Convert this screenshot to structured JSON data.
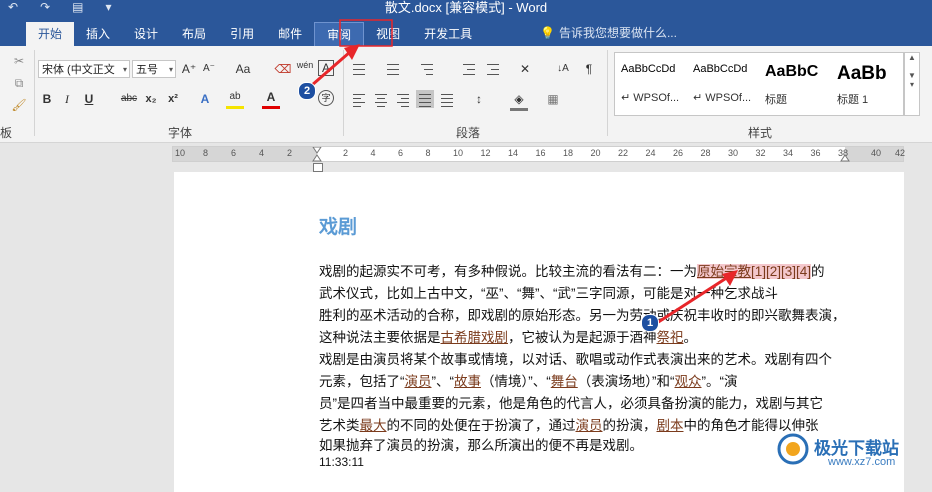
{
  "titlebar": {
    "title": "散文.docx [兼容模式] - Word",
    "qat": [
      "↶",
      "↷",
      "▤",
      "▾"
    ]
  },
  "tabs": [
    {
      "label": "开始",
      "name": "tab-home"
    },
    {
      "label": "插入",
      "name": "tab-insert"
    },
    {
      "label": "设计",
      "name": "tab-design"
    },
    {
      "label": "布局",
      "name": "tab-layout"
    },
    {
      "label": "引用",
      "name": "tab-references"
    },
    {
      "label": "邮件",
      "name": "tab-mailings"
    },
    {
      "label": "审阅",
      "name": "tab-review"
    },
    {
      "label": "视图",
      "name": "tab-view"
    },
    {
      "label": "开发工具",
      "name": "tab-developer"
    }
  ],
  "tellme": "告诉我您想要做什么...",
  "ribbon": {
    "font_name": "宋体 (中文正文",
    "font_size": "五号",
    "groups": {
      "font": "字体",
      "paragraph": "段落",
      "styles": "样式",
      "clipboard": "板"
    },
    "font_buttons": {
      "bold": "B",
      "italic": "I",
      "underline": "U",
      "strike": "abc",
      "sub": "x₂",
      "sup": "x²",
      "grow": "A⁺",
      "shrink": "A⁻",
      "case": "Aa",
      "wen": "wén",
      "a_box": "A",
      "font_color": "A",
      "highlight": "ab",
      "circle": "字"
    }
  },
  "styles": [
    {
      "sample": "AaBbCcDd",
      "name": "↵ WPSOf..."
    },
    {
      "sample": "AaBbCcDd",
      "name": "↵ WPSOf..."
    },
    {
      "sample": "AaBbC",
      "name": "标题"
    },
    {
      "sample": "AaBb",
      "name": "标题 1"
    }
  ],
  "ruler": {
    "left_nums": [
      "10",
      "8",
      "6",
      "4",
      "2"
    ],
    "right_nums": [
      "2",
      "4",
      "6",
      "8",
      "10",
      "12",
      "14",
      "16",
      "18",
      "20",
      "22",
      "24",
      "26",
      "28",
      "30",
      "32",
      "34",
      "36",
      "38"
    ],
    "end_nums": [
      "40",
      "42"
    ]
  },
  "document": {
    "heading": "戏剧",
    "p1": {
      "l1a": "戏剧的起源实不可考，有多种假说。比较主流的看法有二：一为",
      "l1_link": "原始宗教",
      "l1_refs": "[1][2][3][4]",
      "l1b": "的",
      "l2": "武术仪式，比如上古中文，“巫”、“舞”、“武”三字同源，可能是对一种乞求战斗",
      "l3": "胜利的巫术活动的合称，即戏剧的原始形态。另一为劳动或庆祝丰收时的即兴歌舞表演，",
      "l4a": "这种说法主要依据是",
      "l4_link1": "古希腊戏剧",
      "l4b": "，它被认为是起源于酒神",
      "l4_link2": "祭祀",
      "l4c": "。"
    },
    "p2": {
      "l1": "戏剧是由演员将某个故事或情境，以对话、歌唱或动作式表演出来的艺术。戏剧有四个",
      "l2a": "元素，包括了“",
      "l2_link1": "演员",
      "l2b": "”、“",
      "l2_link2": "故事",
      "l2c": "（情境）”、“",
      "l2_link3": "舞台",
      "l2d": "（表演场地）”和“",
      "l2_link4": "观众",
      "l2e": "”。“演",
      "l3": "员”是四者当中最重要的元素，他是角色的代言人，必须具备扮演的能力，戏剧与其它",
      "l4a": "艺术类",
      "l4_link1": "最大",
      "l4b": "的不同的处便在于扮演了，通过",
      "l4_link2": "演员",
      "l4c": "的扮演，",
      "l4_link3": "剧本",
      "l4d": "中的角色才能得以伸张",
      "l5": "如果抛弃了演员的扮演，那么所演出的便不再是戏剧。"
    },
    "timestamp": "11:33:11"
  },
  "annotations": {
    "badge1": "1",
    "badge2": "2",
    "arrow_color": "#e8262a"
  },
  "watermark": {
    "text": "极光下载站",
    "url": "www.xz7.com"
  }
}
